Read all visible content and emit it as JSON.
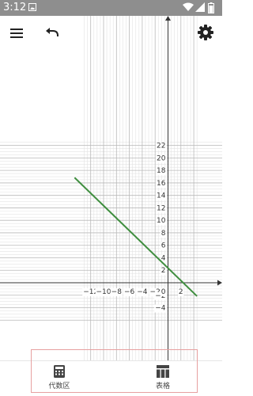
{
  "status_bar": {
    "time": "3:12",
    "icons": [
      "image-icon",
      "wifi-icon",
      "signal-icon",
      "battery-icon"
    ]
  },
  "toolbar": {
    "menu_icon": "menu-icon",
    "undo_icon": "undo-icon",
    "settings_icon": "gear-icon"
  },
  "bottom_tabs": [
    {
      "label": "代数区",
      "icon": "calculator-icon"
    },
    {
      "label": "表格",
      "icon": "table-icon"
    }
  ],
  "colors": {
    "line": "#3f8e3f",
    "axis": "#333333",
    "major_grid": "#b9b9b9",
    "minor_grid": "#e3e3e3",
    "status_bar": "#8e8e8e",
    "highlight_border": "#e7a0a0"
  },
  "chart_data": {
    "type": "line",
    "series": [
      {
        "x": [
          -14.5,
          4.5
        ],
        "y": [
          16.85,
          -2.15
        ]
      }
    ],
    "x_ticks": [
      -12,
      -10,
      -8,
      -6,
      -4,
      -2,
      2
    ],
    "y_ticks": [
      -4,
      -2,
      2,
      4,
      6,
      8,
      10,
      12,
      14,
      16,
      18,
      20,
      22
    ],
    "origin_label": "0",
    "xlim": [
      -13.4,
      4.5
    ],
    "ylim": [
      -6.2,
      22.8
    ],
    "grid": true
  }
}
